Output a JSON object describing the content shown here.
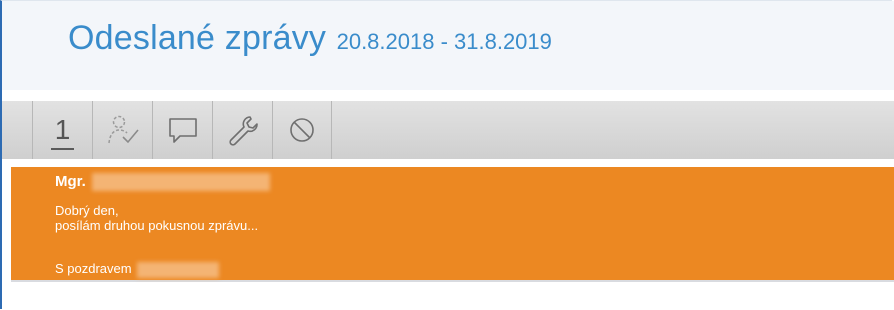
{
  "header": {
    "title": "Odeslané zprávy",
    "date_range": "20.8.2018 - 31.8.2019"
  },
  "toolbar": {
    "items": [
      {
        "label": "1",
        "icon": "number-one-icon"
      },
      {
        "label": "",
        "icon": "user-check-icon"
      },
      {
        "label": "",
        "icon": "speech-bubble-icon"
      },
      {
        "label": "",
        "icon": "wrench-icon"
      },
      {
        "label": "",
        "icon": "block-icon"
      }
    ]
  },
  "message": {
    "sender_prefix": "Mgr.",
    "greeting": "Dobrý den,",
    "preview": "posílám druhou pokusnou zprávu...",
    "signoff": "S pozdravem",
    "highlight_color": "#ec8822"
  },
  "colors": {
    "accent": "#3a8ccb",
    "frame": "#2d6bb3"
  }
}
